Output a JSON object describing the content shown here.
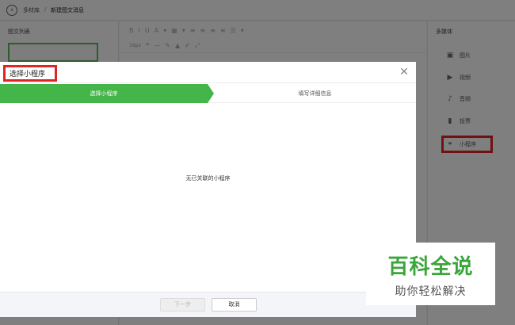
{
  "breadcrumb": {
    "root": "多材库",
    "separator": "/",
    "current": "新建图文消息"
  },
  "left_panel": {
    "title": "图文列表"
  },
  "toolbar": {
    "row1": [
      "B",
      "I",
      "U",
      "A",
      "▾",
      "▦",
      "▾",
      "≡",
      "≡",
      "≡",
      "≡",
      "☰",
      "▾"
    ],
    "font_size": "16px",
    "row2": [
      "❝",
      "—",
      "✎",
      "▲",
      "✐",
      "⤢"
    ]
  },
  "right_panel": {
    "title": "多媒体",
    "items": [
      {
        "icon": "image-icon",
        "label": "图片"
      },
      {
        "icon": "video-icon",
        "label": "视频"
      },
      {
        "icon": "audio-icon",
        "label": "音频"
      },
      {
        "icon": "vote-icon",
        "label": "投票"
      },
      {
        "icon": "mini-program-icon",
        "label": "小程序"
      }
    ]
  },
  "dialog": {
    "title": "选择小程序",
    "close_symbol": "✕",
    "steps": [
      "选择小程序",
      "填写详细信息"
    ],
    "empty_message": "无已关联的小程序",
    "next_label": "下一步",
    "cancel_label": "取消"
  },
  "watermark": {
    "title": "百科全说",
    "subtitle": "助你轻松解决"
  },
  "colors": {
    "accent_green": "#44b549",
    "highlight_red": "#e02424",
    "watermark_green": "#3aa53a"
  }
}
